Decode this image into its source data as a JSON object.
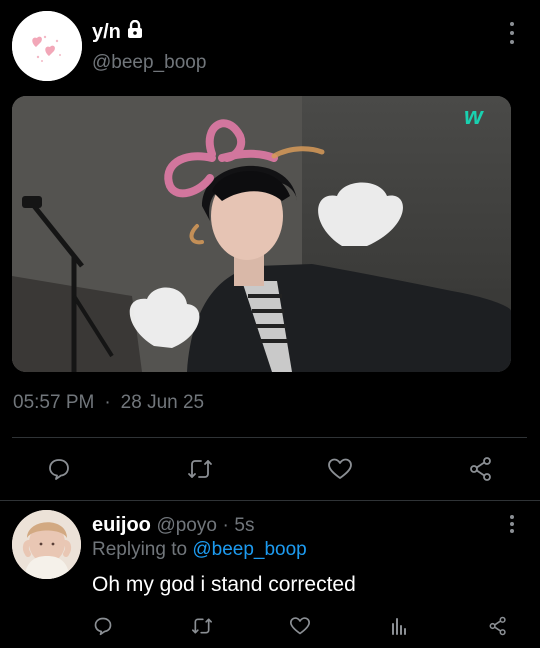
{
  "tweet": {
    "display_name": "y/n",
    "handle": "@beep_boop",
    "time": "05:57 PM",
    "separator": "·",
    "date": "28 Jun 25",
    "media_logo": "w"
  },
  "icons": {
    "lock": "lock-icon",
    "more": "more-vertical-icon",
    "reply": "reply-icon",
    "retweet": "retweet-icon",
    "like": "heart-icon",
    "share": "share-icon",
    "views": "views-icon"
  },
  "reply": {
    "display_name": "euijoo",
    "handle": "@poyo",
    "separator": "·",
    "age": "5s",
    "replying_prefix": "Replying to",
    "replying_handle": "@beep_boop",
    "text": "Oh my god i stand corrected"
  },
  "colors": {
    "background": "#000000",
    "text": "#e7e9ea",
    "muted": "#71767b",
    "link": "#1d9bf0",
    "media_logo": "#19d1b0"
  }
}
